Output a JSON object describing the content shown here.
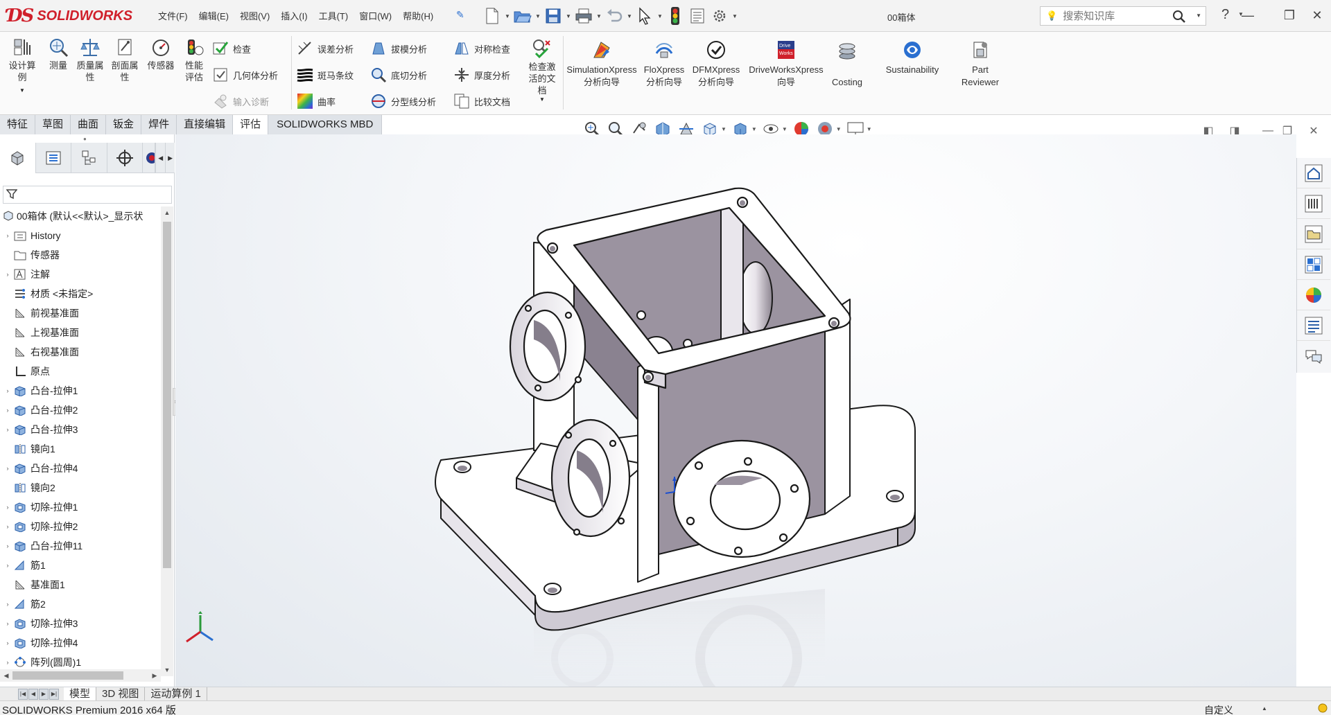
{
  "app": {
    "name": "SOLIDWORKS",
    "document_title": "00箱体"
  },
  "menu": [
    "文件(F)",
    "编辑(E)",
    "视图(V)",
    "插入(I)",
    "工具(T)",
    "窗口(W)",
    "帮助(H)"
  ],
  "search": {
    "placeholder": "搜索知识库"
  },
  "help_label": "?",
  "command_manager": {
    "large_buttons": [
      {
        "label": "设计算例",
        "icon": "design-study-icon"
      },
      {
        "label": "测量",
        "icon": "measure-icon"
      },
      {
        "label": "质量属性",
        "icon": "mass-properties-icon"
      },
      {
        "label": "剖面属性",
        "icon": "section-properties-icon"
      },
      {
        "label": "传感器",
        "icon": "sensor-icon"
      },
      {
        "label": "性能评估",
        "icon": "performance-evaluation-icon"
      }
    ],
    "check_buttons": [
      {
        "label": "检查",
        "icon": "check-icon",
        "enabled": true
      },
      {
        "label": "几何体分析",
        "icon": "geometry-analysis-icon",
        "enabled": true
      },
      {
        "label": "输入诊断",
        "icon": "import-diagnostics-icon",
        "enabled": false
      }
    ],
    "analysis_col1": [
      {
        "label": "误差分析",
        "icon": "deviation-analysis-icon"
      },
      {
        "label": "斑马条纹",
        "icon": "zebra-stripes-icon"
      },
      {
        "label": "曲率",
        "icon": "curvature-icon"
      }
    ],
    "analysis_col2": [
      {
        "label": "拔模分析",
        "icon": "draft-analysis-icon"
      },
      {
        "label": "底切分析",
        "icon": "undercut-analysis-icon"
      },
      {
        "label": "分型线分析",
        "icon": "parting-line-analysis-icon"
      }
    ],
    "analysis_col3": [
      {
        "label": "对称检查",
        "icon": "symmetry-check-icon"
      },
      {
        "label": "厚度分析",
        "icon": "thickness-analysis-icon"
      },
      {
        "label": "比较文档",
        "icon": "compare-documents-icon"
      }
    ],
    "check_active_doc": {
      "label": "检查激活的文档",
      "icon": "check-active-document-icon"
    },
    "xpress": [
      {
        "line1": "SimulationXpress",
        "line2": "分析向导",
        "icon": "simulationxpress-icon"
      },
      {
        "line1": "FloXpress",
        "line2": "分析向导",
        "icon": "floxpress-icon"
      },
      {
        "line1": "DFMXpress",
        "line2": "分析向导",
        "icon": "dfmxpress-icon"
      },
      {
        "line1": "DriveWorksXpress",
        "line2": "向导",
        "icon": "driveworksxpress-icon"
      },
      {
        "line1": "",
        "line2": "Costing",
        "icon": "costing-icon"
      },
      {
        "line1": "Sustainability",
        "line2": "",
        "icon": "sustainability-icon"
      },
      {
        "line1": "Part",
        "line2": "Reviewer",
        "icon": "part-reviewer-icon"
      }
    ],
    "driveworks_badge": [
      "Drive",
      "Works"
    ]
  },
  "tabs": [
    {
      "label": "特征",
      "active": false
    },
    {
      "label": "草图",
      "active": false
    },
    {
      "label": "曲面",
      "active": false
    },
    {
      "label": "钣金",
      "active": false
    },
    {
      "label": "焊件",
      "active": false
    },
    {
      "label": "直接编辑",
      "active": false
    },
    {
      "label": "评估",
      "active": true
    },
    {
      "label": "SOLIDWORKS MBD",
      "active": false
    }
  ],
  "feature_tree": {
    "root": "00箱体  (默认<<默认>_显示状",
    "items": [
      {
        "label": "History",
        "icon": "history-folder-icon",
        "expandable": true
      },
      {
        "label": "传感器",
        "icon": "sensor-folder-icon",
        "expandable": false
      },
      {
        "label": "注解",
        "icon": "annotations-icon",
        "expandable": true
      },
      {
        "label": "材质 <未指定>",
        "icon": "material-icon",
        "expandable": false
      },
      {
        "label": "前视基准面",
        "icon": "plane-icon",
        "expandable": false
      },
      {
        "label": "上视基准面",
        "icon": "plane-icon",
        "expandable": false
      },
      {
        "label": "右视基准面",
        "icon": "plane-icon",
        "expandable": false
      },
      {
        "label": "原点",
        "icon": "origin-icon",
        "expandable": false
      },
      {
        "label": "凸台-拉伸1",
        "icon": "extrude-boss-icon",
        "expandable": true
      },
      {
        "label": "凸台-拉伸2",
        "icon": "extrude-boss-icon",
        "expandable": true
      },
      {
        "label": "凸台-拉伸3",
        "icon": "extrude-boss-icon",
        "expandable": true
      },
      {
        "label": "镜向1",
        "icon": "mirror-icon",
        "expandable": false
      },
      {
        "label": "凸台-拉伸4",
        "icon": "extrude-boss-icon",
        "expandable": true
      },
      {
        "label": "镜向2",
        "icon": "mirror-icon",
        "expandable": false
      },
      {
        "label": "切除-拉伸1",
        "icon": "extrude-cut-icon",
        "expandable": true
      },
      {
        "label": "切除-拉伸2",
        "icon": "extrude-cut-icon",
        "expandable": true
      },
      {
        "label": "凸台-拉伸11",
        "icon": "extrude-boss-icon",
        "expandable": true
      },
      {
        "label": "筋1",
        "icon": "rib-icon",
        "expandable": true
      },
      {
        "label": "基准面1",
        "icon": "plane-icon",
        "expandable": false
      },
      {
        "label": "筋2",
        "icon": "rib-icon",
        "expandable": true
      },
      {
        "label": "切除-拉伸3",
        "icon": "extrude-cut-icon",
        "expandable": true
      },
      {
        "label": "切除-拉伸4",
        "icon": "extrude-cut-icon",
        "expandable": true
      },
      {
        "label": "阵列(圆周)1",
        "icon": "circular-pattern-icon",
        "expandable": true
      }
    ]
  },
  "bottom_tabs": [
    {
      "label": "模型",
      "active": true
    },
    {
      "label": "3D 视图",
      "active": false
    },
    {
      "label": "运动算例 1",
      "active": false
    }
  ],
  "status": {
    "text": "SOLIDWORKS Premium 2016 x64 版",
    "units": "自定义"
  },
  "colors": {
    "brand_red": "#d0202b",
    "model_face": "#9b93a0",
    "model_edge": "#1a1a1a"
  }
}
